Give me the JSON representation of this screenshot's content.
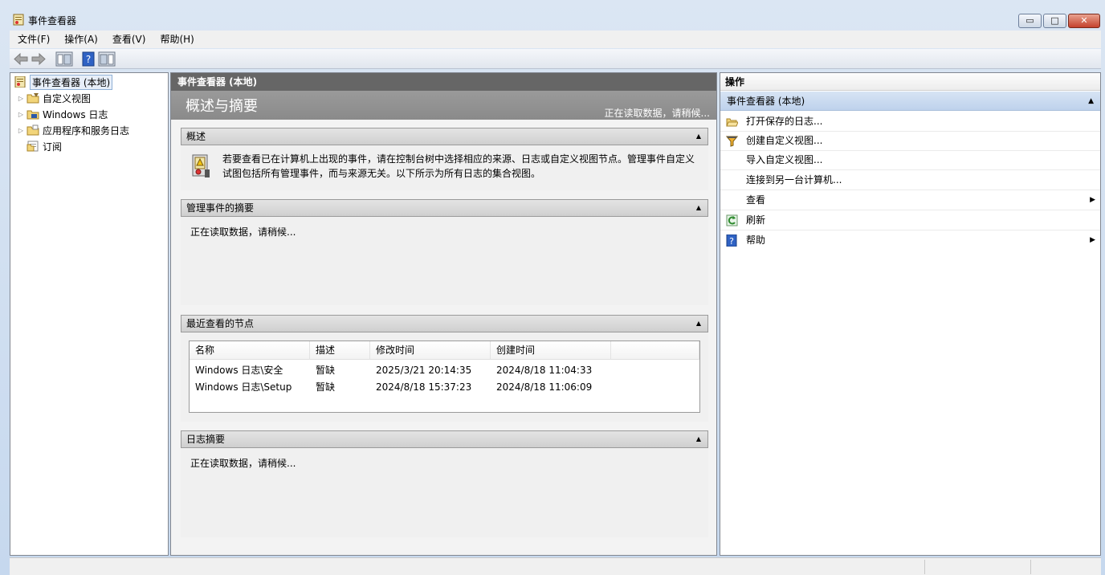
{
  "window": {
    "title": "事件查看器",
    "min_glyph": "▭",
    "max_glyph": "□",
    "close_glyph": "✕"
  },
  "menu": [
    "文件(F)",
    "操作(A)",
    "查看(V)",
    "帮助(H)"
  ],
  "tree": {
    "items": [
      {
        "label": "事件查看器 (本地)",
        "expandable": false,
        "selected": true
      },
      {
        "label": "自定义视图",
        "expandable": true
      },
      {
        "label": "Windows 日志",
        "expandable": true
      },
      {
        "label": "应用程序和服务日志",
        "expandable": true
      },
      {
        "label": "订阅",
        "expandable": false
      }
    ]
  },
  "center": {
    "header": "事件查看器 (本地)",
    "banner_title": "概述与摘要",
    "banner_status": "正在读取数据，请稍候...",
    "overview": {
      "title": "概述",
      "text": "若要查看已在计算机上出现的事件，请在控制台树中选择相应的来源、日志或自定义视图节点。管理事件自定义试图包括所有管理事件，而与来源无关。以下所示为所有日志的集合视图。"
    },
    "admin_summary": {
      "title": "管理事件的摘要",
      "status": "正在读取数据，请稍候..."
    },
    "recent_nodes": {
      "title": "最近查看的节点",
      "columns": [
        "名称",
        "描述",
        "修改时间",
        "创建时间",
        ""
      ],
      "rows": [
        [
          "Windows 日志\\安全",
          "暂缺",
          "2025/3/21 20:14:35",
          "2024/8/18 11:04:33"
        ],
        [
          "Windows 日志\\Setup",
          "暂缺",
          "2024/8/18 15:37:23",
          "2024/8/18 11:06:09"
        ]
      ]
    },
    "log_summary": {
      "title": "日志摘要",
      "status": "正在读取数据，请稍候..."
    },
    "collapse_glyph": "▲"
  },
  "actions": {
    "header": "操作",
    "group": "事件查看器 (本地)",
    "items": [
      {
        "label": "打开保存的日志...",
        "icon": "folder-open-icon"
      },
      {
        "label": "创建自定义视图...",
        "icon": "filter-icon"
      },
      {
        "label": "导入自定义视图...",
        "icon": ""
      },
      {
        "label": "连接到另一台计算机...",
        "icon": ""
      },
      {
        "label": "查看",
        "icon": "",
        "submenu": true
      },
      {
        "label": "刷新",
        "icon": "refresh-icon"
      },
      {
        "label": "帮助",
        "icon": "help-icon",
        "submenu": true
      }
    ],
    "submenu_glyph": "▶"
  }
}
